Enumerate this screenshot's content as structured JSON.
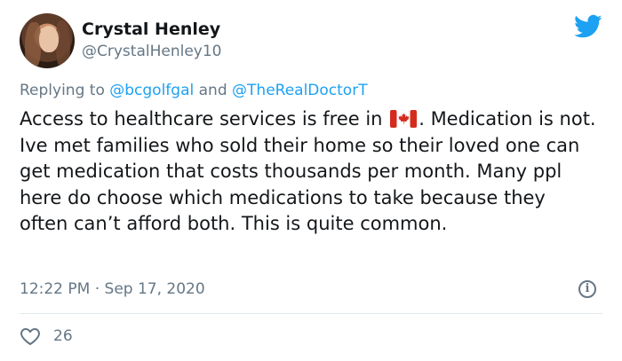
{
  "author": {
    "name": "Crystal Henley",
    "handle": "@CrystalHenley10"
  },
  "reply": {
    "prefix": "Replying to ",
    "mention1": "@bcgolfgal",
    "joiner": " and ",
    "mention2": "@TheRealDoctorT"
  },
  "tweet": {
    "line1_before_flag": "Access to healthcare services is free in",
    "flag_icon": "canada-flag-emoji",
    "line1_after_flag": ".",
    "rest": "Medication is not. Ive met families who sold their home so their loved one can get medication that costs thousands per month. Many ppl here do choose which medications to take because they often can’t afford both. This is quite common."
  },
  "meta": {
    "timestamp": "12:22 PM · Sep 17, 2020"
  },
  "actions": {
    "likes": "26"
  },
  "colors": {
    "brand": "#1da1f2",
    "muted": "#657786",
    "text": "#14171a",
    "flag_red": "#d52b1e"
  },
  "icons": {
    "brand": "twitter-bird-icon",
    "info": "info-icon",
    "like": "heart-icon"
  }
}
